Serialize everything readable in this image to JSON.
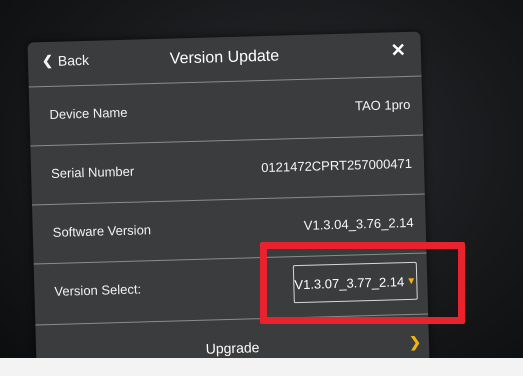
{
  "header": {
    "back_label": "Back",
    "title": "Version Update"
  },
  "rows": [
    {
      "label": "Device Name",
      "value": "TAO 1pro"
    },
    {
      "label": "Serial Number",
      "value": "0121472CPRT257000471"
    },
    {
      "label": "Software Version",
      "value": "V1.3.04_3.76_2.14"
    }
  ],
  "version_select": {
    "label": "Version Select:",
    "selected": "V1.3.07_3.77_2.14"
  },
  "upgrade_label": "Upgrade",
  "colors": {
    "accent": "#f2b40c",
    "highlight": "#e8232d",
    "panel": "#3a3c3d"
  },
  "icons": {
    "back": "chevron-left-icon",
    "close": "close-icon",
    "dropdown": "chevron-down-icon",
    "upgrade": "chevron-right-icon"
  }
}
